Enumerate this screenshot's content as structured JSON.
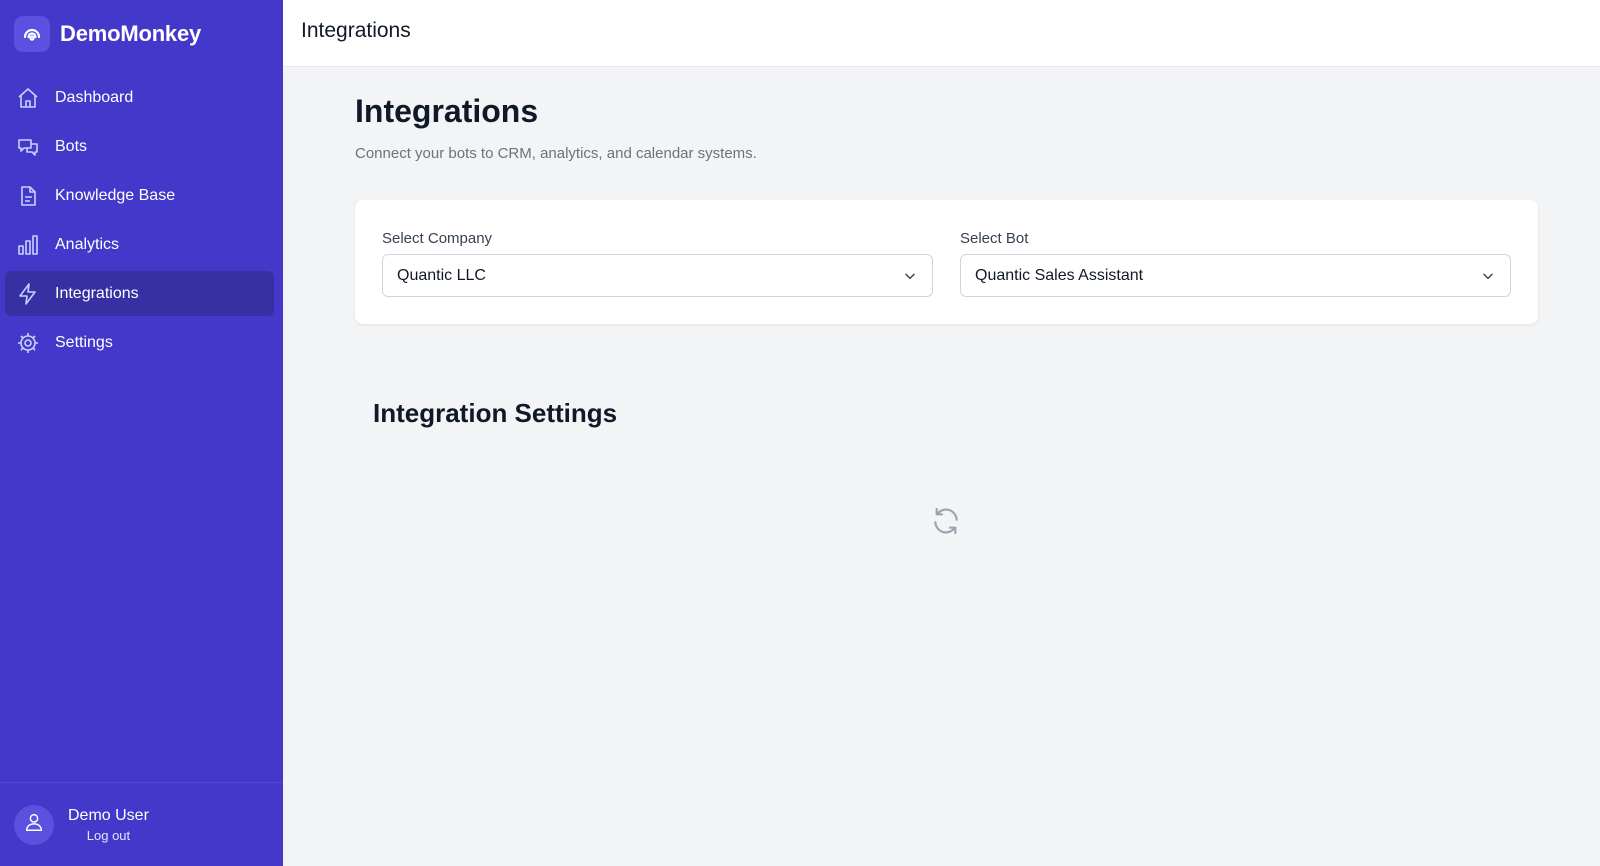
{
  "app": {
    "brand_name": "DemoMonkey",
    "brand_icon": "eye-spiral-icon"
  },
  "sidebar": {
    "items": [
      {
        "label": "Dashboard",
        "icon": "home-icon",
        "active": false
      },
      {
        "label": "Bots",
        "icon": "chat-bubbles-icon",
        "active": false
      },
      {
        "label": "Knowledge Base",
        "icon": "document-icon",
        "active": false
      },
      {
        "label": "Analytics",
        "icon": "bar-chart-icon",
        "active": false
      },
      {
        "label": "Integrations",
        "icon": "lightning-icon",
        "active": true
      },
      {
        "label": "Settings",
        "icon": "gear-icon",
        "active": false
      }
    ],
    "user": {
      "name": "Demo User",
      "logout_label": "Log out",
      "icon": "user-icon"
    }
  },
  "header": {
    "title": "Integrations"
  },
  "main": {
    "title": "Integrations",
    "subtitle": "Connect your bots to CRM, analytics, and calendar systems.",
    "company_select": {
      "label": "Select Company",
      "value": "Quantic LLC"
    },
    "bot_select": {
      "label": "Select Bot",
      "value": "Quantic Sales Assistant"
    },
    "section_title": "Integration Settings",
    "loading_icon": "refresh-icon"
  },
  "colors": {
    "sidebar_bg": "#4338ca",
    "sidebar_active": "#3730a3",
    "page_bg": "#f3f4f6"
  }
}
